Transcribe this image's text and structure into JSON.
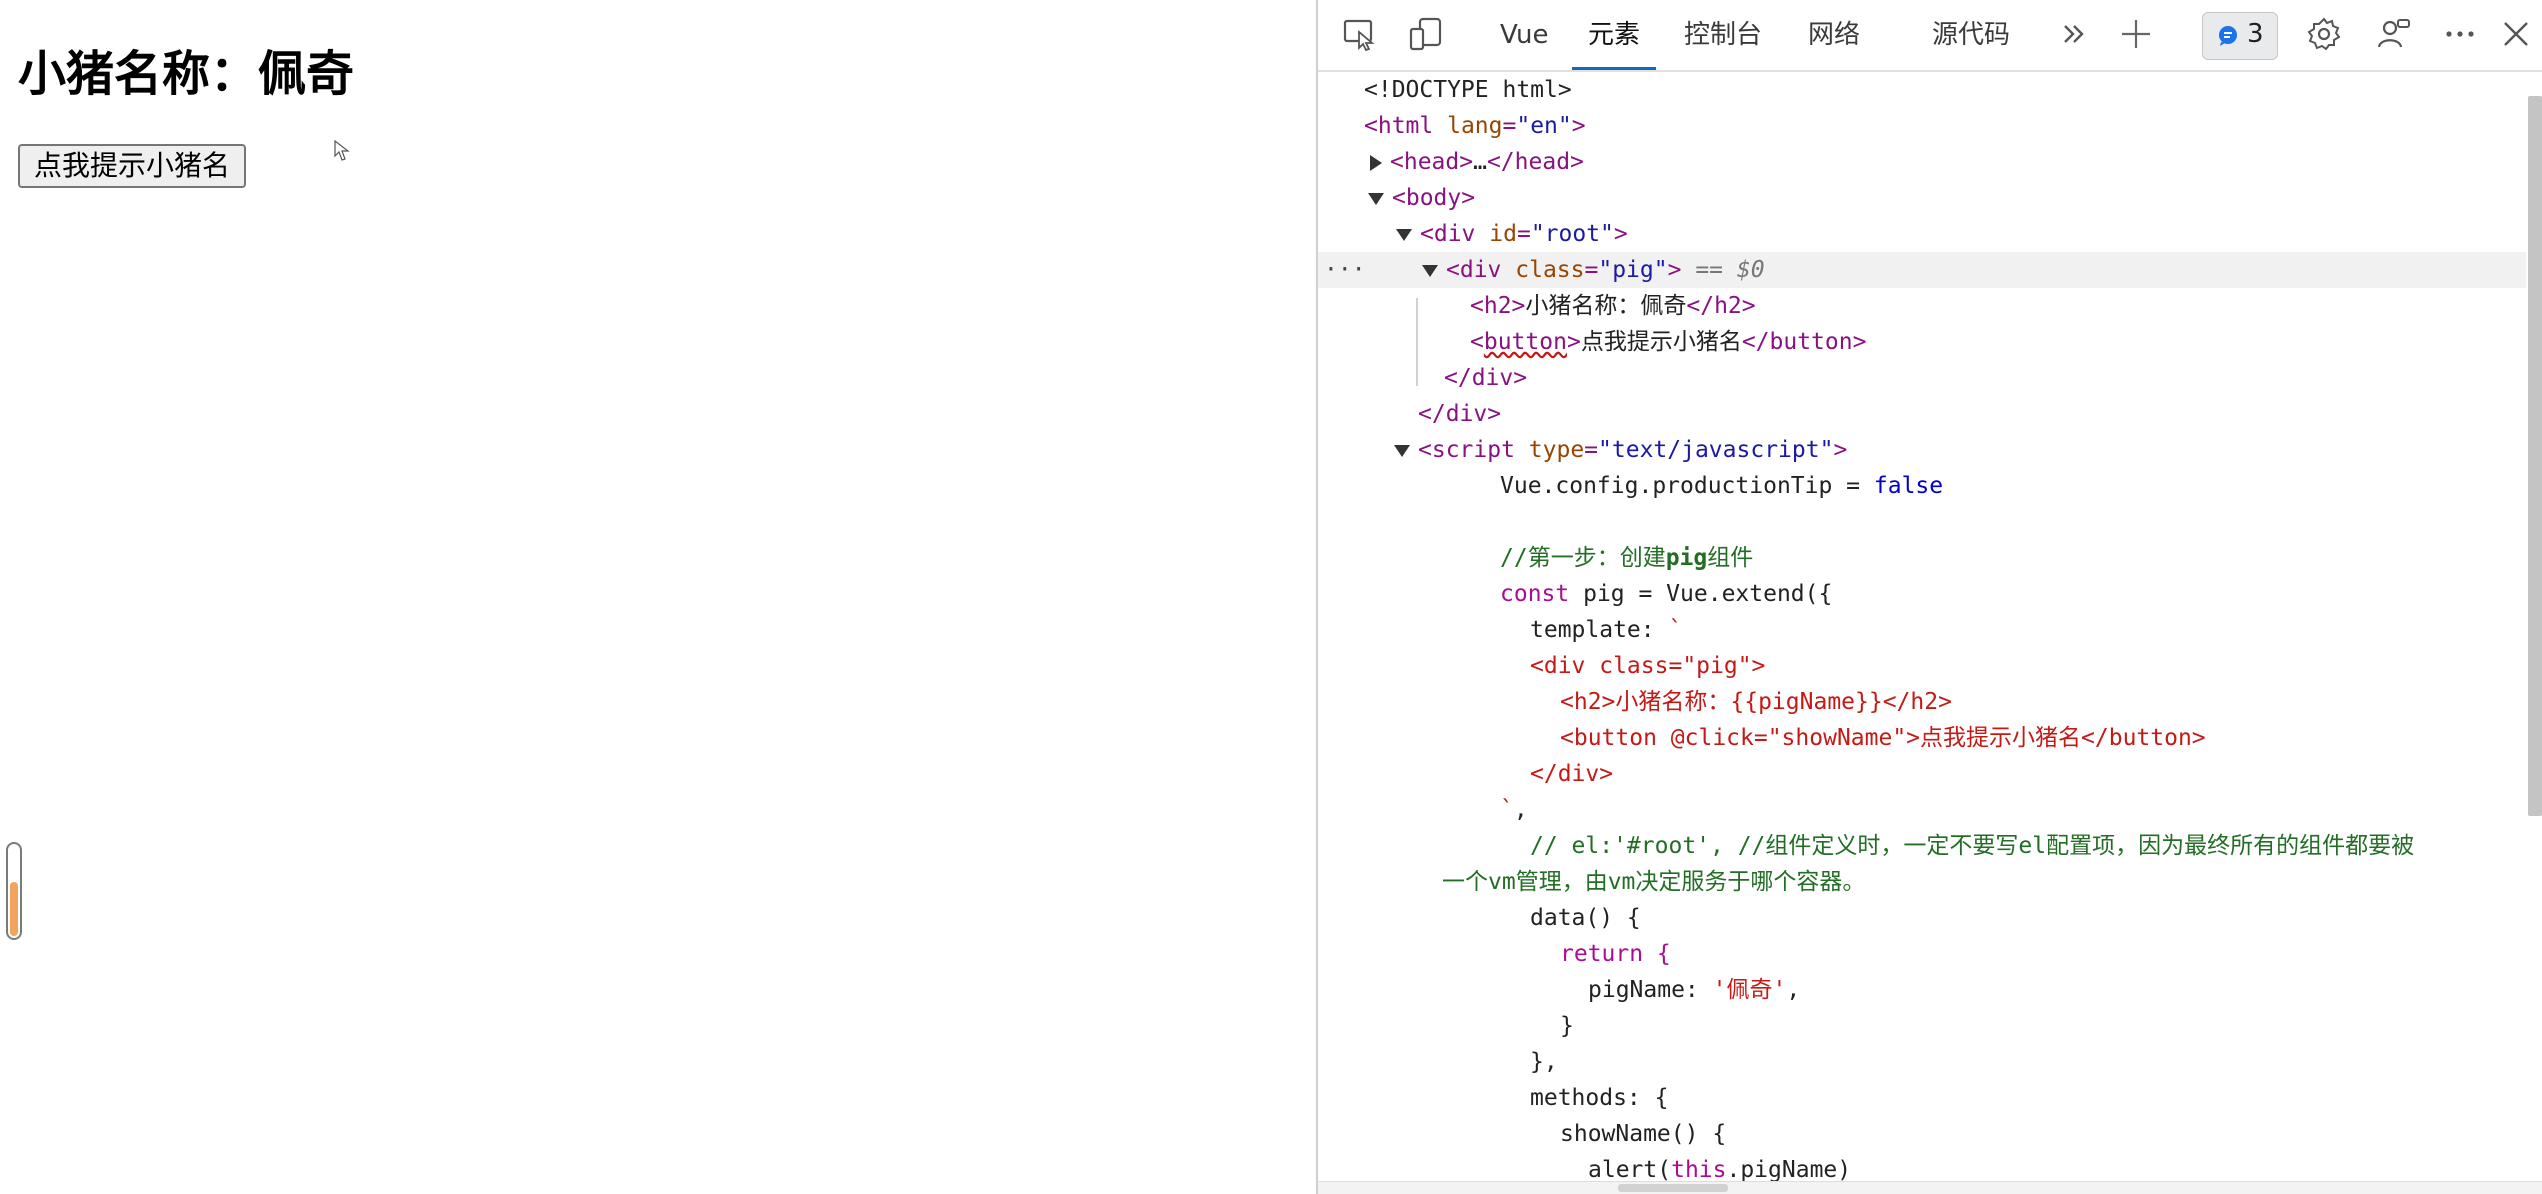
{
  "preview": {
    "heading": "小猪名称：佩奇",
    "button_label": "点我提示小猪名"
  },
  "devtools": {
    "tabs": [
      {
        "label": "Vue"
      },
      {
        "label": "元素"
      },
      {
        "label": "控制台"
      },
      {
        "label": "网络"
      },
      {
        "label": "源代码"
      }
    ],
    "active_tab": "元素",
    "issues_count": "3",
    "selected_suffix": "== $0",
    "code": {
      "l1": "<!DOCTYPE html>",
      "l2_open": "<html ",
      "l2_attr": "lang",
      "l2_eq": "=",
      "l2_val": "\"en\"",
      "l2_close": ">",
      "l3_a": "<head>",
      "l3_b": "…",
      "l3_c": "</head>",
      "l4": "<body>",
      "l5_open": "<div ",
      "l5_attr": "id",
      "l5_eq": "=",
      "l5_val": "\"root\"",
      "l5_close": ">",
      "l6_open": "<div ",
      "l6_attr": "class",
      "l6_eq": "=",
      "l6_val": "\"pig\"",
      "l6_close": ">",
      "l7_open": "<h2>",
      "l7_text": "小猪名称：佩奇",
      "l7_close": "</h2>",
      "l8_open": "<",
      "l8_tag": "button",
      "l8_gt": ">",
      "l8_text": "点我提示小猪名",
      "l8_close": "</button>",
      "l9": "</div>",
      "l10": "</div>",
      "l11_open": "<script ",
      "l11_attr": "type",
      "l11_eq": "=",
      "l11_val": "\"text/javascript\"",
      "l11_close": ">",
      "l12_a": "Vue.config.productionTip = ",
      "l12_b": "false",
      "l14_a": "//第一步：创建",
      "l14_b": "pig",
      "l14_c": "组件",
      "l15_a": "const",
      "l15_b": " pig = Vue.extend({",
      "l16_a": "template: ",
      "l16_b": "`",
      "l17": "<div class=\"pig\">",
      "l18": "<h2>小猪名称：{{pigName}}</h2>",
      "l19": "<button @click=\"showName\">点我提示小猪名</button>",
      "l20": "</div>",
      "l21_a": "`",
      "l21_b": ",",
      "l22": "// el:'#root', //组件定义时，一定不要写el配置项，因为最终所有的组件都要被",
      "l23": "一个vm管理，由vm决定服务于哪个容器。",
      "l24": "data() {",
      "l25": "return {",
      "l26_a": "pigName: ",
      "l26_b": "'佩奇'",
      "l26_c": ",",
      "l27": "}",
      "l28": "},",
      "l29": "methods: {",
      "l30": "showName() {",
      "l31_a": "alert(",
      "l31_b": "this",
      "l31_c": ".pigName)"
    }
  }
}
